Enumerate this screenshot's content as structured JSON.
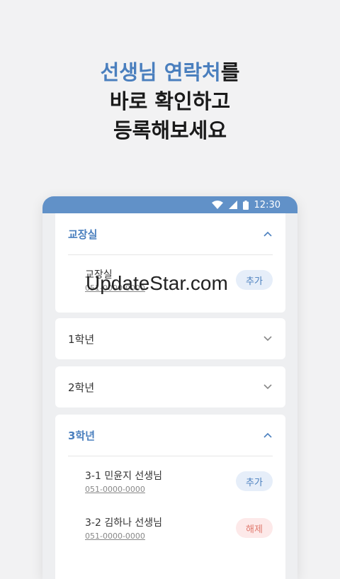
{
  "headline": {
    "accent": "선생님 연락처",
    "line1_rest": "를",
    "line2": "바로 확인하고",
    "line3": "등록해보세요"
  },
  "status_bar": {
    "time": "12:30"
  },
  "watermark": "UpdateStar.com",
  "sections": [
    {
      "title": "교장실",
      "expanded": true,
      "contacts": [
        {
          "name": "교장실",
          "phone": "051-0000-0000",
          "action": "추가"
        }
      ]
    },
    {
      "title": "1학년",
      "expanded": false
    },
    {
      "title": "2학년",
      "expanded": false
    },
    {
      "title": "3학년",
      "expanded": true,
      "contacts": [
        {
          "name": "3-1 민윤지 선생님",
          "phone": "051-0000-0000",
          "action": "추가"
        },
        {
          "name": "3-2 김하나 선생님",
          "phone": "051-0000-0000",
          "action": "해제"
        }
      ]
    }
  ],
  "colors": {
    "accent": "#4a7fbe",
    "status_bar": "#6191c8",
    "remove": "#e07a6f"
  }
}
